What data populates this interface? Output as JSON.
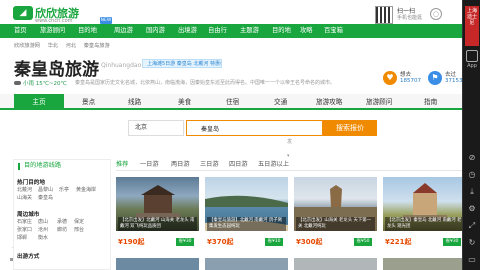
{
  "header": {
    "logo_text": "欣欣旅游",
    "logo_sub": "www.cncn.com",
    "scan_label": "扫一扫",
    "scan_sub": "手机也能逛"
  },
  "nav": {
    "items": [
      "首页",
      "旅游顾问",
      "目的地",
      "周边游",
      "国内游",
      "出境游",
      "自由行",
      "主题游",
      "目的地",
      "攻略",
      "百宝箱"
    ],
    "new_badge": "NEW"
  },
  "breadcrumb": [
    "欣欣旅游网",
    "华北",
    "河北",
    "秦皇岛旅游"
  ],
  "page": {
    "title": "秦皇岛旅游",
    "pinyin": "Qinhuangdao",
    "weather": "小雨  15℃~20℃",
    "description": "秦皇岛是国家历史文化名城，北依燕山，南临渤海，因秦始皇东巡至此而得名。中国唯一一个以帝王名号命名的城市。",
    "ad_text": "上海滩5日游 秦皇岛 北戴河 特惠价"
  },
  "stats": [
    {
      "label": "想去",
      "value": "185707",
      "color": "#f08a00"
    },
    {
      "label": "去过",
      "value": "371534",
      "color": "#3a8ee6"
    }
  ],
  "tabs": [
    "主页",
    "景点",
    "线路",
    "美食",
    "住宿",
    "交通",
    "旅游攻略",
    "旅游顾问",
    "指南"
  ],
  "search": {
    "city": "北京",
    "city_dropdown": "出发▾",
    "query": "秦皇岛",
    "button_label": "搜索报价"
  },
  "sidebar": {
    "title": "目的地游线路",
    "sections": [
      {
        "name": "热门目的地",
        "links": [
          "北戴河",
          "昌黎山",
          "乐亭",
          "黄金海岸",
          "山海关",
          "秦皇岛"
        ]
      },
      {
        "name": "周边城市",
        "links": [
          "石家庄",
          "唐山",
          "承德",
          "保定",
          "张家口",
          "沧州",
          "廊坊",
          "邢台",
          "邯郸",
          "衡水"
        ]
      },
      {
        "name": "出游方式",
        "links": []
      }
    ]
  },
  "filter_tags": [
    "推荐",
    "一日游",
    "两日游",
    "三日游",
    "四日游",
    "五日游以上"
  ],
  "cards": [
    {
      "caption": "【北京出发】北戴河 山海关 老龙头 南戴河 双飞纯玩品质团",
      "price": "¥190起",
      "badge": "省¥30"
    },
    {
      "caption": "【秦皇岛旅游】北戴河 南戴河 鸽子窝 集发生态园纯玩",
      "price": "¥370起",
      "badge": "省¥10"
    },
    {
      "caption": "【北京出发】山海关 老龙头 天下第一关 北戴河纯玩",
      "price": "¥300起",
      "badge": "省¥50"
    },
    {
      "caption": "【北京出发】秦皇岛 北戴河 南戴河 老龙头 观光团",
      "price": "¥221起",
      "badge": "省¥30"
    }
  ],
  "rail": {
    "ad_text": "上海迪士尼",
    "app_label": "App"
  },
  "colors": {
    "brand": "#1aa63f",
    "accent": "#f08a00",
    "price": "#e64a00"
  }
}
